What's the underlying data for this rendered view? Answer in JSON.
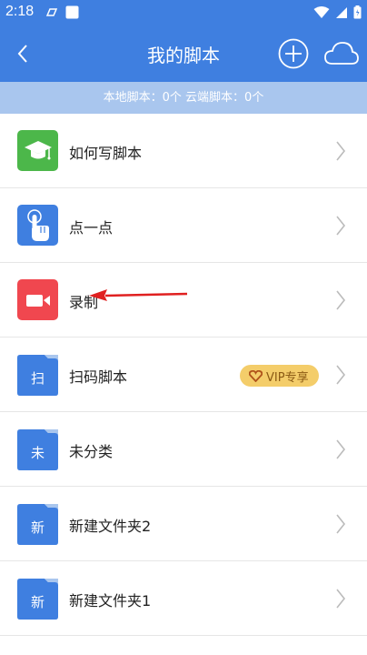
{
  "status_bar": {
    "time": "2:18",
    "icons": [
      "app-notification-icon",
      "square-notification-icon",
      "wifi-icon",
      "signal-icon",
      "battery-icon"
    ]
  },
  "header": {
    "title": "我的脚本",
    "back_icon": "back-chevron-icon",
    "add_icon": "add-circle-icon",
    "cloud_icon": "cloud-icon",
    "color": "#3f7fe0"
  },
  "info_bar": {
    "text": "本地脚本：0个 云端脚本：0个",
    "color": "#a9c6ee"
  },
  "items": [
    {
      "label": "如何写脚本",
      "icon": "graduation-cap-icon",
      "icon_color": "#4cb74a"
    },
    {
      "label": "点一点",
      "icon": "tap-hand-icon",
      "icon_color": "#3f7fe0"
    },
    {
      "label": "录制",
      "icon": "video-camera-icon",
      "icon_color": "#f0474f"
    },
    {
      "label": "扫码脚本",
      "icon": "folder-icon",
      "folder_char": "扫",
      "badge": "VIP专享",
      "icon_color": "#3f7fe0"
    },
    {
      "label": "未分类",
      "icon": "folder-icon",
      "folder_char": "未",
      "icon_color": "#3f7fe0"
    },
    {
      "label": "新建文件夹2",
      "icon": "folder-icon",
      "folder_char": "新",
      "icon_color": "#3f7fe0"
    },
    {
      "label": "新建文件夹1",
      "icon": "folder-icon",
      "folder_char": "新",
      "icon_color": "#3f7fe0"
    }
  ],
  "annotation": {
    "icon": "red-arrow-icon",
    "color": "#e02020"
  },
  "badge_color": "#f4cd6a"
}
